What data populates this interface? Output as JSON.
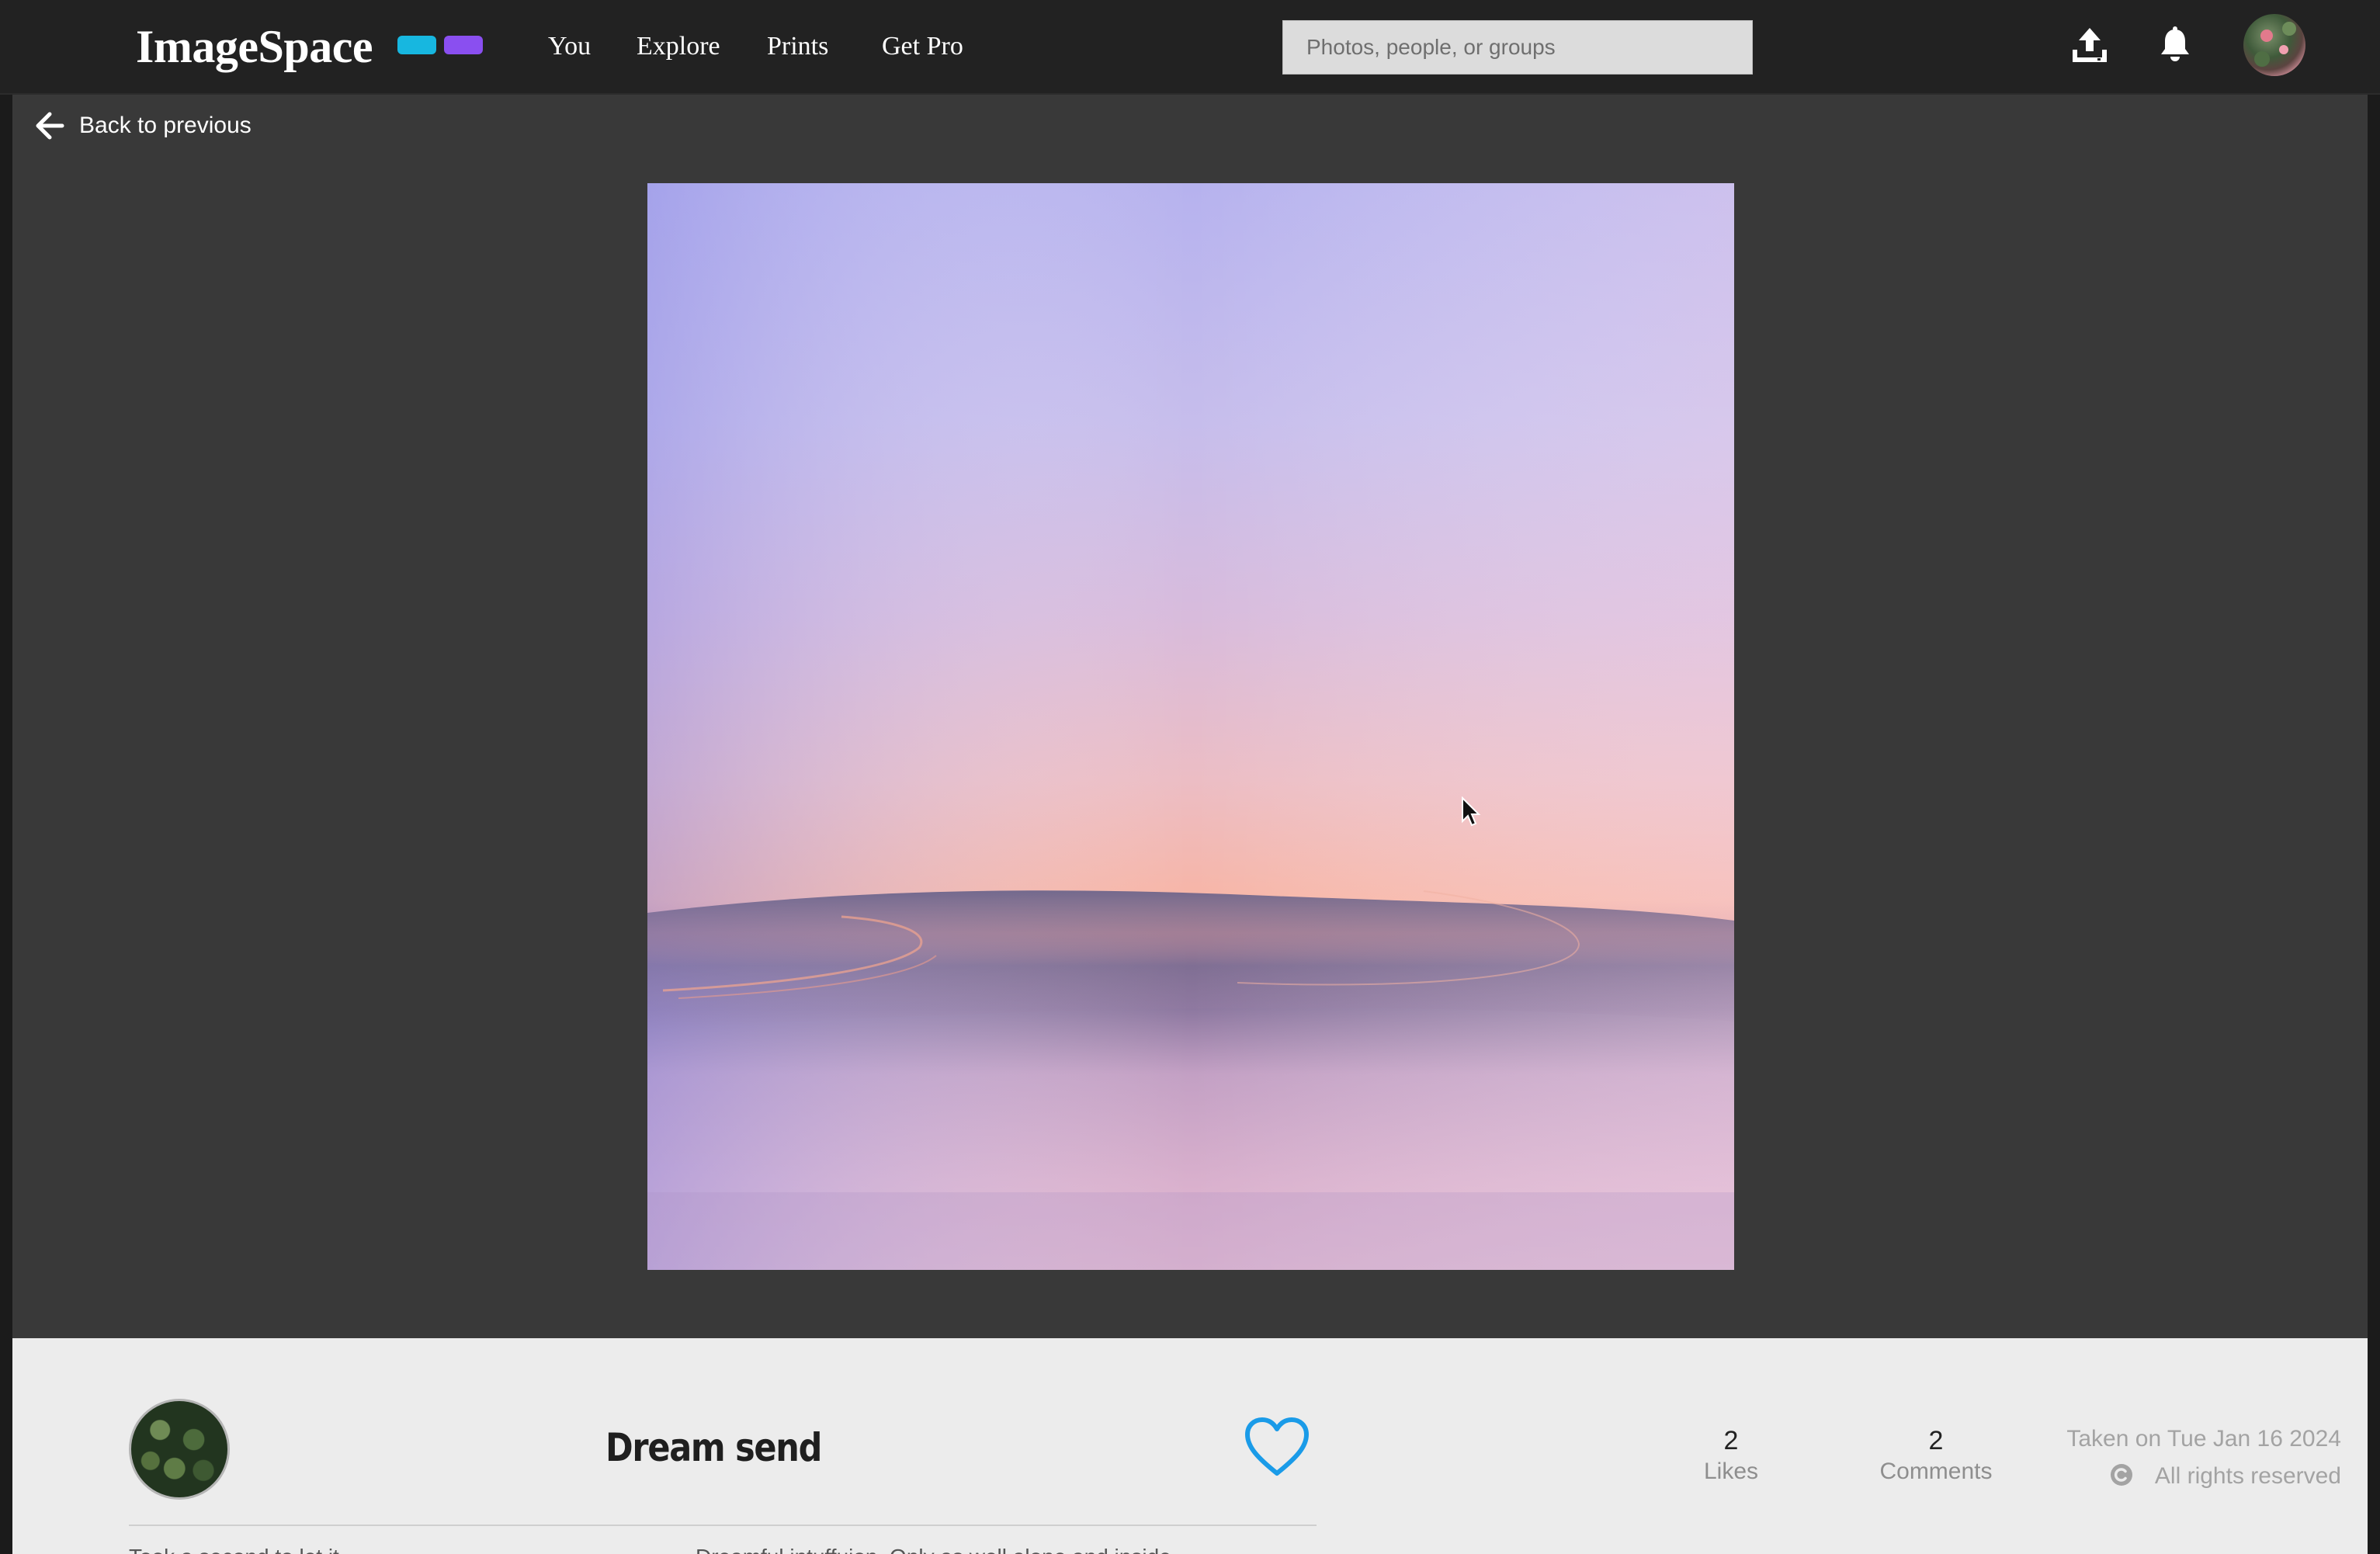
{
  "app": {
    "name": "ImageSpace",
    "brand_colors": [
      "#17b7e0",
      "#8a4ff0"
    ]
  },
  "nav": {
    "items": [
      {
        "label": "You"
      },
      {
        "label": "Explore"
      },
      {
        "label": "Prints"
      },
      {
        "label": "Get Pro"
      }
    ],
    "search_placeholder": "Photos, people, or groups",
    "icons": [
      "upload-icon",
      "bell-icon",
      "user-avatar"
    ]
  },
  "back": {
    "label": "Back to previous",
    "icon": "arrow-left-icon"
  },
  "photo": {
    "subject": "blurred pastel sunset over water"
  },
  "details": {
    "title": "Dream send",
    "like_icon": "heart-outline-icon",
    "like_color": "#1a9be8",
    "stats": [
      {
        "value": "2",
        "label": "Likes"
      },
      {
        "value": "2",
        "label": "Comments"
      }
    ],
    "taken_on": "Taken on Tue Jan 16 2024",
    "rights": "All rights reserved",
    "rights_icon": "copyright-icon",
    "description_left": "Took a second to let it ",
    "description_right": "Dreamful intuffuion. Only as well alone and inside"
  }
}
